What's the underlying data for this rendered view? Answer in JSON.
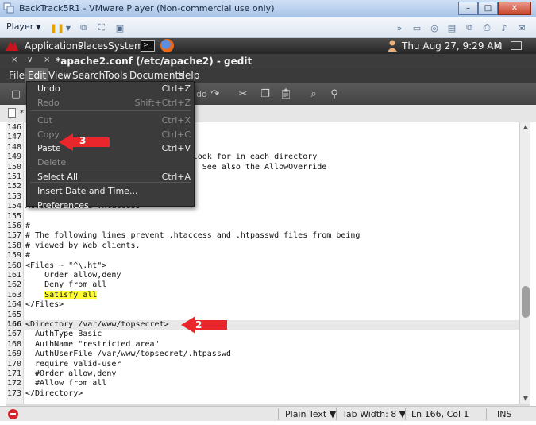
{
  "window": {
    "title": "BackTrack5R1 - VMware Player (Non-commercial use only)",
    "minimize": "–",
    "maximize": "□",
    "close": "✕"
  },
  "vm_toolbar": {
    "player_label": "Player",
    "caret": "▼"
  },
  "gnome_panel": {
    "menus": [
      "Applications",
      "Places",
      "System"
    ],
    "terminal_glyph": ">_",
    "clock": "Thu Aug 27,  9:29 AM"
  },
  "gedit": {
    "title": "*apache2.conf (/etc/apache2) - gedit",
    "title_controls": [
      "×",
      "∨",
      "×"
    ],
    "menubar": [
      "File",
      "Edit",
      "View",
      "Search",
      "Tools",
      "Documents",
      "Help"
    ],
    "toolbar_ghost_text": [
      "do"
    ]
  },
  "tab": {
    "label": "*"
  },
  "edit_menu": {
    "items": [
      {
        "label": "Undo",
        "accel": "Ctrl+Z",
        "disabled": false
      },
      {
        "label": "Redo",
        "accel": "Shift+Ctrl+Z",
        "disabled": true
      },
      {
        "label": "Cut",
        "accel": "Ctrl+X",
        "disabled": true
      },
      {
        "label": "Copy",
        "accel": "Ctrl+C",
        "disabled": true
      },
      {
        "label": "Paste",
        "accel": "Ctrl+V",
        "disabled": false
      },
      {
        "label": "Delete",
        "accel": "",
        "disabled": true
      },
      {
        "label": "Select All",
        "accel": "Ctrl+A",
        "disabled": false
      },
      {
        "label": "Insert Date and Time...",
        "accel": "",
        "disabled": false
      },
      {
        "label": "Preferences",
        "accel": "",
        "disabled": false
      }
    ]
  },
  "editor": {
    "current_line": 166,
    "lines": [
      {
        "n": "146",
        "text": ""
      },
      {
        "n": "147",
        "text": ""
      },
      {
        "n": "148",
        "text": ""
      },
      {
        "n": "149",
        "text": "                             le to look for in each directory"
      },
      {
        "n": "150",
        "text": "                             tives.  See also the AllowOverride"
      },
      {
        "n": "151",
        "text": ""
      },
      {
        "n": "152",
        "text": ""
      },
      {
        "n": "153",
        "text": ""
      },
      {
        "n": "154",
        "text": "AccessFileName .htaccess"
      },
      {
        "n": "155",
        "text": ""
      },
      {
        "n": "156",
        "text": "#"
      },
      {
        "n": "157",
        "text": "# The following lines prevent .htaccess and .htpasswd files from being"
      },
      {
        "n": "158",
        "text": "# viewed by Web clients."
      },
      {
        "n": "159",
        "text": "#"
      },
      {
        "n": "160",
        "text": "<Files ~ \"^\\.ht\">"
      },
      {
        "n": "161",
        "text": "    Order allow,deny"
      },
      {
        "n": "162",
        "text": "    Deny from all"
      },
      {
        "n": "163",
        "text": "    ",
        "highlight": "Satisfy all"
      },
      {
        "n": "164",
        "text": "</Files>"
      },
      {
        "n": "165",
        "text": ""
      },
      {
        "n": "166",
        "text": "<Directory /var/www/topsecret>"
      },
      {
        "n": "167",
        "text": "  AuthType Basic"
      },
      {
        "n": "168",
        "text": "  AuthName \"restricted area\""
      },
      {
        "n": "169",
        "text": "  AuthUserFile /var/www/topsecret/.htpasswd"
      },
      {
        "n": "170",
        "text": "  require valid-user"
      },
      {
        "n": "171",
        "text": "  #Order allow,deny"
      },
      {
        "n": "172",
        "text": "  #Allow from all"
      },
      {
        "n": "173",
        "text": "</Directory>"
      }
    ]
  },
  "statusbar": {
    "language": "Plain Text ▼",
    "tab_width": "Tab Width:  8 ▼",
    "position": "Ln 166, Col 1",
    "mode": "INS"
  },
  "annotations": {
    "arrow_paste": "3",
    "arrow_directory": "2",
    "arrow_color": "#e8262b"
  },
  "colors": {
    "highlight": "#ffff33",
    "menu_bg": "#3b3b3b",
    "panel_bg": "#2e2e2e"
  }
}
